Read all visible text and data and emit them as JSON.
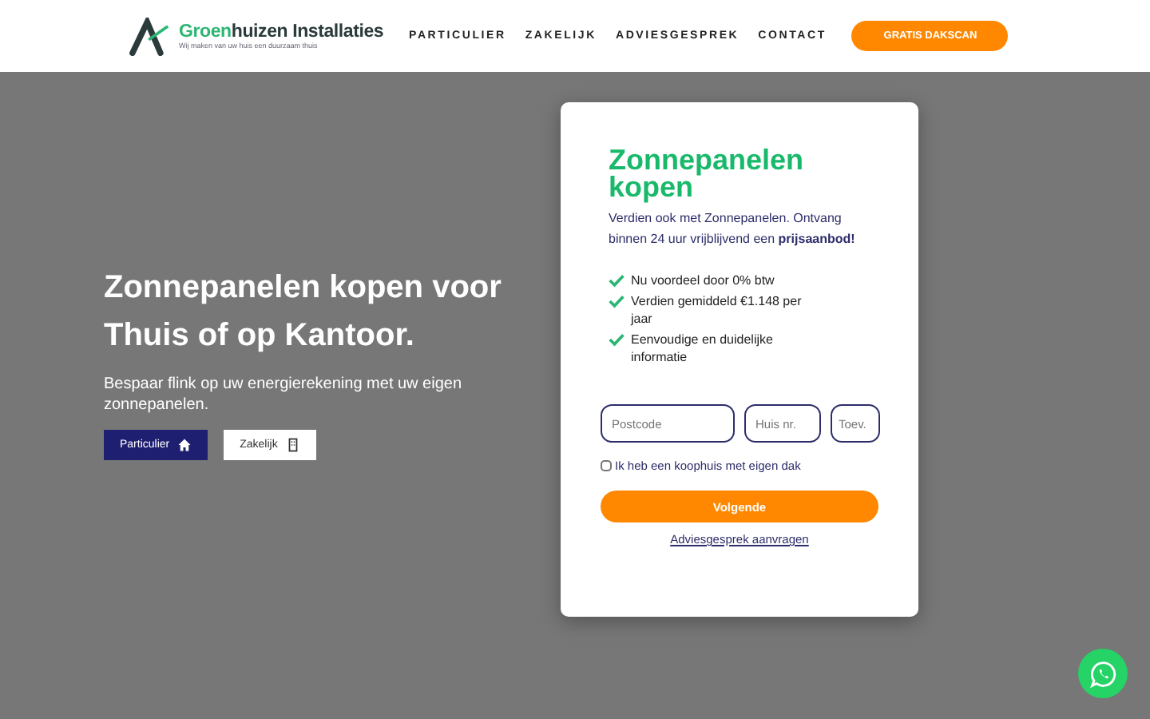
{
  "header": {
    "logo": {
      "accent": "Groen",
      "rest": "huizen Installaties",
      "tagline": "Wij maken van uw huis een duurzaam thuis"
    },
    "nav": [
      {
        "label": "PARTICULIER"
      },
      {
        "label": "ZAKELIJK"
      },
      {
        "label": "ADVIESGESPREK"
      },
      {
        "label": "CONTACT"
      }
    ],
    "cta": "GRATIS DAKSCAN"
  },
  "hero": {
    "title": "Zonnepanelen kopen voor Thuis of op Kantoor.",
    "subtitle": "Bespaar flink op uw energierekening met uw eigen zonnepanelen.",
    "buttons": [
      {
        "label": "Particulier",
        "kind": "home",
        "selected": true
      },
      {
        "label": "Zakelijk",
        "kind": "building",
        "selected": false
      }
    ]
  },
  "card": {
    "title": "Zonnepanelen kopen",
    "intro": "Verdien ook met Zonnepanelen. Ontvang binnen 24 uur vrijblijvend een **prijsaanbod!**",
    "benefits": [
      "Nu voordeel door 0% btw",
      "Verdien gemiddeld €1.148 per jaar",
      "Eenvoudige en duidelijke informatie"
    ],
    "fields": [
      {
        "placeholder": "Postcode"
      },
      {
        "placeholder": "Huis nr."
      },
      {
        "placeholder": "Toev."
      }
    ],
    "checkbox": {
      "label": "Ik heb een koophuis met eigen dak",
      "checked": false
    },
    "submit": "Volgende",
    "link": "Adviesgesprek aanvragen"
  }
}
